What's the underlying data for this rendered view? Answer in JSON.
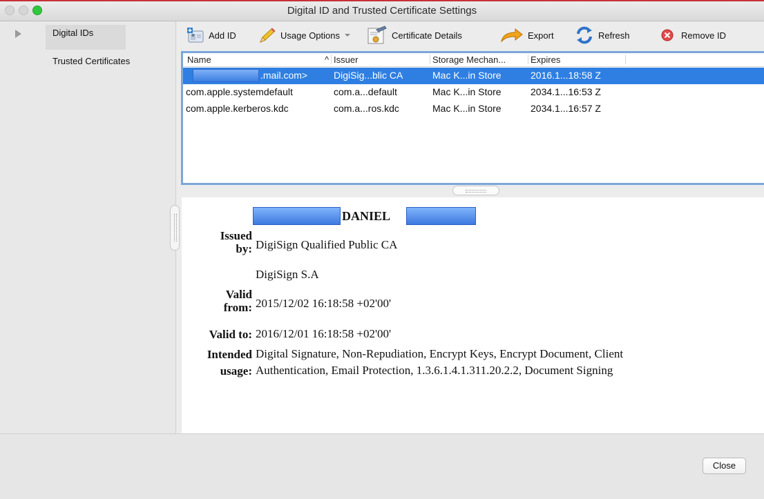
{
  "window": {
    "title": "Digital ID and Trusted Certificate Settings"
  },
  "sidebar": {
    "items": [
      {
        "label": "Digital IDs",
        "selected": true
      },
      {
        "label": "Trusted Certificates",
        "selected": false
      }
    ]
  },
  "toolbar": {
    "add_id": "Add ID",
    "usage_options": "Usage Options",
    "certificate_details": "Certificate Details",
    "export": "Export",
    "refresh": "Refresh",
    "remove_id": "Remove ID"
  },
  "table": {
    "columns": [
      "Name",
      "Issuer",
      "Storage Mechan...",
      "Expires"
    ],
    "sort_indicator": "^",
    "rows": [
      {
        "name": ".mail.com>",
        "issuer": "DigiSig...blic CA",
        "storage": "Mac K...in Store",
        "expires": "2016.1...18:58 Z",
        "selected": true
      },
      {
        "name": "com.apple.systemdefault",
        "issuer": "com.a...default",
        "storage": "Mac K...in Store",
        "expires": "2034.1...16:53 Z",
        "selected": false
      },
      {
        "name": "com.apple.kerberos.kdc",
        "issuer": "com.a...ros.kdc",
        "storage": "Mac K...in Store",
        "expires": "2034.1...16:57 Z",
        "selected": false
      }
    ]
  },
  "details": {
    "subject_name": "DANIEL",
    "issued_by_label_1": "Issued",
    "issued_by_label_2": "by:",
    "issued_by": "DigiSign Qualified Public CA",
    "organization": "DigiSign S.A",
    "valid_from_label_1": "Valid",
    "valid_from_label_2": "from:",
    "valid_from": "2015/12/02 16:18:58 +02'00'",
    "valid_to_label": "Valid to:",
    "valid_to": "2016/12/01 16:18:58 +02'00'",
    "intended_usage_label_1": "Intended",
    "intended_usage_label_2": "usage:",
    "intended_usage_line_1": "Digital Signature, Non-Repudiation, Encrypt Keys, Encrypt Document, Client",
    "intended_usage_line_2": "Authentication, Email Protection, 1.3.6.1.4.1.311.20.2.2, Document Signing"
  },
  "footer": {
    "close_label": "Close"
  },
  "colors": {
    "selection": "#2f7fe2",
    "focus_ring": "#7ba6d9",
    "zoom_button": "#30c73f"
  }
}
